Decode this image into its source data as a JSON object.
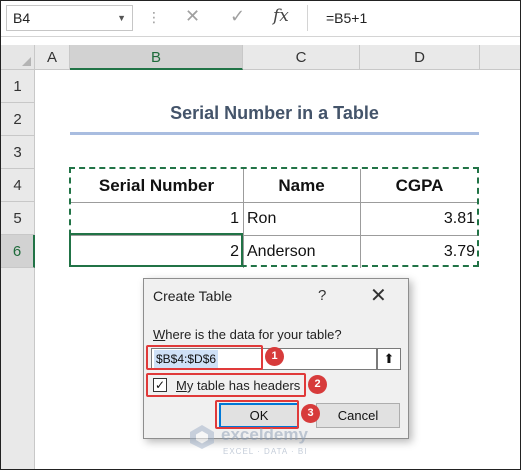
{
  "formula_bar": {
    "name_box": "B4",
    "name_box_dropdown": "▼",
    "separator": "⋮",
    "cancel_glyph": "✕",
    "enter_glyph": "✓",
    "fx_label": "fx",
    "formula": "=B5+1"
  },
  "grid": {
    "columns": [
      "A",
      "B",
      "C",
      "D"
    ],
    "rows": [
      "1",
      "2",
      "3",
      "4",
      "5",
      "6"
    ],
    "selected_column": "B",
    "selected_row": "6"
  },
  "sheet": {
    "title": "Serial Number in a Table",
    "table": {
      "headers": [
        "Serial Number",
        "Name",
        "CGPA"
      ],
      "rows": [
        {
          "serial": "1",
          "name": "Ron",
          "cgpa": "3.81"
        },
        {
          "serial": "2",
          "name": "Anderson",
          "cgpa": "3.79"
        }
      ]
    }
  },
  "dialog": {
    "title": "Create Table",
    "help": "?",
    "close": "✕",
    "prompt": "Where is the data for your table?",
    "range_value": "$B$4:$D$6",
    "collapse_icon": "⬆",
    "checkbox_mark": "✓",
    "checkbox_checked": true,
    "checkbox_label": "My table has headers",
    "ok_label": "OK",
    "cancel_label": "Cancel"
  },
  "callouts": [
    {
      "badge": "1"
    },
    {
      "badge": "2"
    },
    {
      "badge": "3"
    }
  ],
  "watermark": {
    "name": "exceldemy",
    "tagline": "EXCEL · DATA · BI"
  },
  "colors": {
    "excel_green": "#217346",
    "title_text": "#44546a",
    "title_underline": "#a9bde0",
    "callout_red": "#e03a3a",
    "badge_red": "#d73b3b"
  }
}
